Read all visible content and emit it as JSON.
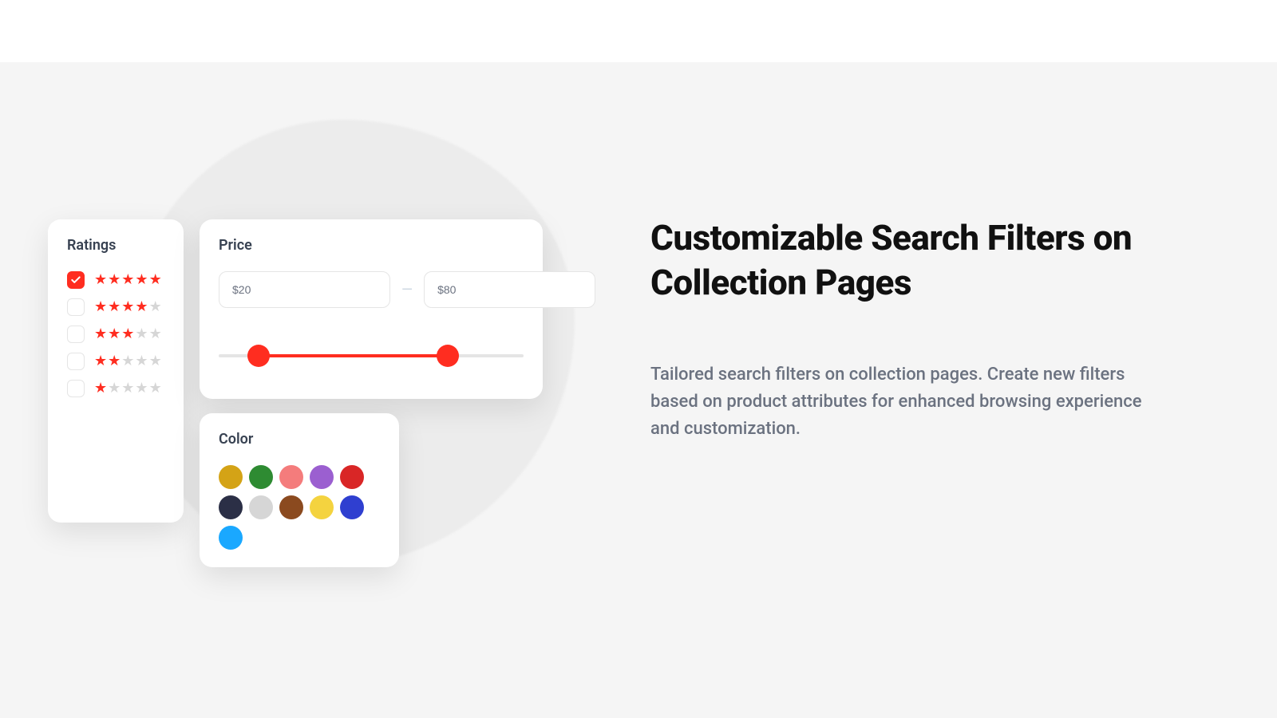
{
  "headline": "Customizable Search Filters on Collection Pages",
  "subcopy": "Tailored search filters on collection pages. Create new filters based on  product attributes for enhanced browsing experience and customization.",
  "ratings": {
    "title": "Ratings",
    "rows": [
      {
        "stars": 5,
        "checked": true
      },
      {
        "stars": 4,
        "checked": false
      },
      {
        "stars": 3,
        "checked": false
      },
      {
        "stars": 2,
        "checked": false
      },
      {
        "stars": 1,
        "checked": false
      }
    ]
  },
  "price": {
    "title": "Price",
    "min_value": "$20",
    "max_value": "$80",
    "slider": {
      "min_pct": 13,
      "max_pct": 75
    }
  },
  "color": {
    "title": "Color",
    "swatches": [
      "#d4a316",
      "#2e8b32",
      "#f47c7c",
      "#9b5fd0",
      "#d92626",
      "#2b2f46",
      "#d6d6d6",
      "#8b4a1f",
      "#f4d33f",
      "#2f3fd0",
      "#1aa8ff"
    ]
  }
}
